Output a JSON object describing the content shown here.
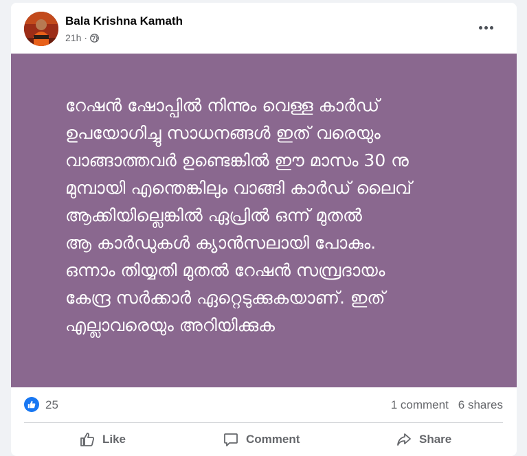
{
  "post": {
    "author": "Bala Krishna Kamath",
    "time": "21h",
    "separator": "·",
    "privacy_icon": "globe-icon",
    "menu_icon": "more-options-icon",
    "text": "റേഷൻ ഷോപ്പിൽ നിന്നും വെള്ള കാർഡ്\nഉപയോഗിച്ചു സാധനങ്ങൾ ഇത് വരെയും\nവാങ്ങാത്തവർ ഉണ്ടെങ്കിൽ ഈ മാസം 30 നു\nമുമ്പായി എന്തെങ്കിലും വാങ്ങി കാർഡ് ലൈവ്\nആക്കിയില്ലെങ്കിൽ ഏപ്രിൽ ഒന്ന് മുതൽ\nആ കാർഡുകൾ ക്യാൻസലായി പോകും.\nഒന്നാം തിയ്യതി മുതൽ റേഷൻ സമ്പ്രദായം\nകേന്ദ്ര സർക്കാർ ഏറ്റെടുക്കുകയാണ്. ഇത്\nഎല്ലാവരെയും അറിയിക്കുക",
    "background_color": "#8a688f",
    "text_color": "#ffffff"
  },
  "stats": {
    "reaction_count": "25",
    "comments": "1 comment",
    "shares": "6 shares"
  },
  "actions": {
    "like": "Like",
    "comment": "Comment",
    "share": "Share"
  },
  "colors": {
    "brand_blue": "#1877f2",
    "secondary_text": "#65676b"
  }
}
